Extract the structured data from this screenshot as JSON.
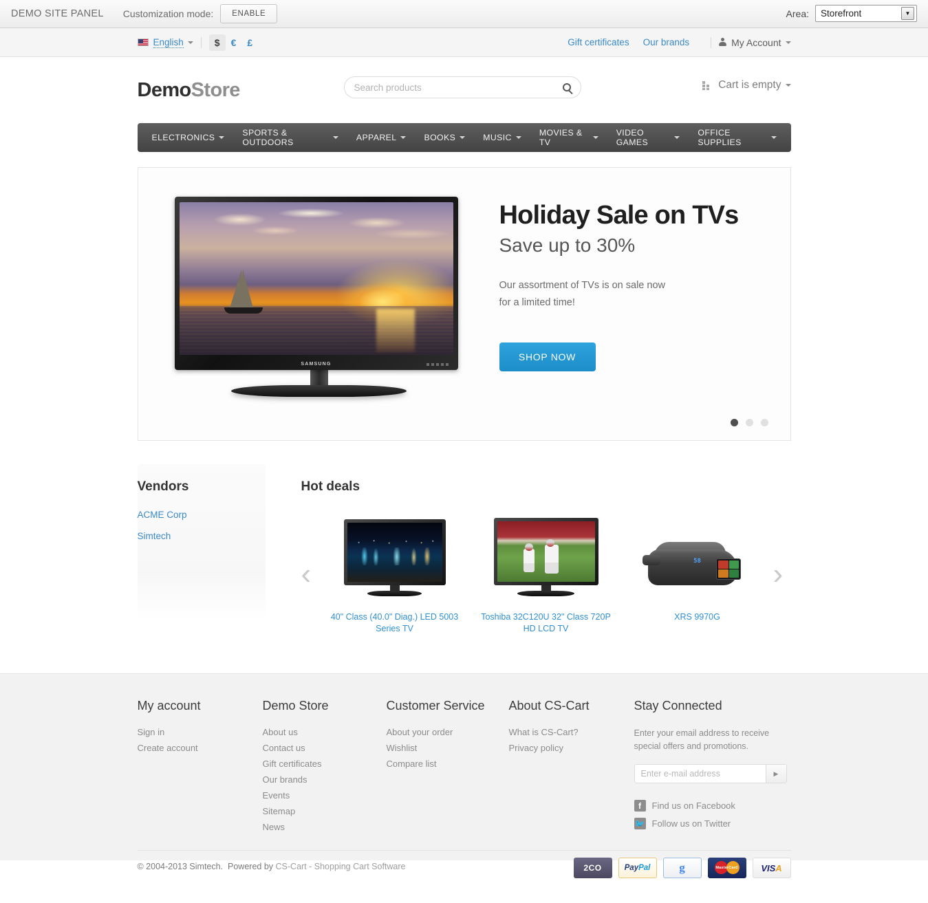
{
  "demo_panel": {
    "title": "DEMO SITE PANEL",
    "customization_label": "Customization mode:",
    "enable_button": "ENABLE",
    "area_label": "Area:",
    "area_value": "Storefront"
  },
  "top_bar": {
    "language": "English",
    "currencies": [
      {
        "symbol": "$",
        "active": true
      },
      {
        "symbol": "€",
        "active": false
      },
      {
        "symbol": "£",
        "active": false
      }
    ],
    "links": [
      "Gift certificates",
      "Our brands"
    ],
    "account": "My Account"
  },
  "header": {
    "logo_first": "Demo",
    "logo_second": "Store",
    "search_placeholder": "Search products",
    "search_value": "",
    "cart_text": "Cart is empty"
  },
  "nav": {
    "items": [
      "ELECTRONICS",
      "SPORTS & OUTDOORS",
      "APPAREL",
      "BOOKS",
      "MUSIC",
      "MOVIES & TV",
      "VIDEO GAMES",
      "OFFICE SUPPLIES"
    ]
  },
  "banner": {
    "headline": "Holiday Sale on TVs",
    "subhead": "Save up to 30%",
    "body_line1": "Our assortment of TVs is on sale now",
    "body_line2": "for a limited time!",
    "cta": "SHOP NOW",
    "tv_brand": "SAMSUNG",
    "slides": 3,
    "active_slide": 1,
    "accent_color": "#2393d4"
  },
  "vendors": {
    "title": "Vendors",
    "items": [
      "ACME Corp",
      "Simtech"
    ]
  },
  "hot_deals": {
    "title": "Hot deals",
    "prev_label": "‹",
    "next_label": "›",
    "products": [
      {
        "name": "40\" Class (40.0\" Diag.) LED 5003 Series TV"
      },
      {
        "name": "Toshiba 32C120U 32\" Class 720P HD LCD TV"
      },
      {
        "name": "XRS 9970G",
        "display_value": "58"
      }
    ]
  },
  "footer": {
    "columns": [
      {
        "heading": "My account",
        "links": [
          "Sign in",
          "Create account"
        ]
      },
      {
        "heading": "Demo Store",
        "links": [
          "About us",
          "Contact us",
          "Gift certificates",
          "Our brands",
          "Events",
          "Sitemap",
          "News"
        ]
      },
      {
        "heading": "Customer Service",
        "links": [
          "About your order",
          "Wishlist",
          "Compare list"
        ]
      },
      {
        "heading": "About CS-Cart",
        "links": [
          "What is CS-Cart?",
          "Privacy policy"
        ]
      }
    ],
    "newsletter": {
      "heading": "Stay Connected",
      "description": "Enter your email address to receive special offers and promotions.",
      "placeholder": "Enter e-mail address",
      "value": "",
      "submit_icon": "▶"
    },
    "social": [
      {
        "icon": "f",
        "label": "Find us on Facebook"
      },
      {
        "icon": "🐦",
        "label": "Follow us on Twitter"
      }
    ],
    "copyright": "© 2004-2013 Simtech.",
    "powered_prefix": "Powered by",
    "powered_link": "CS-Cart - Shopping Cart Software",
    "payments": [
      {
        "name": "2CO",
        "label": "2CO"
      },
      {
        "name": "PayPal",
        "label_a": "Pay",
        "label_b": "Pal"
      },
      {
        "name": "Google",
        "label": "g"
      },
      {
        "name": "MasterCard",
        "label": "MasterCard"
      },
      {
        "name": "VISA",
        "label_a": "VIS",
        "label_b": "A"
      }
    ]
  }
}
